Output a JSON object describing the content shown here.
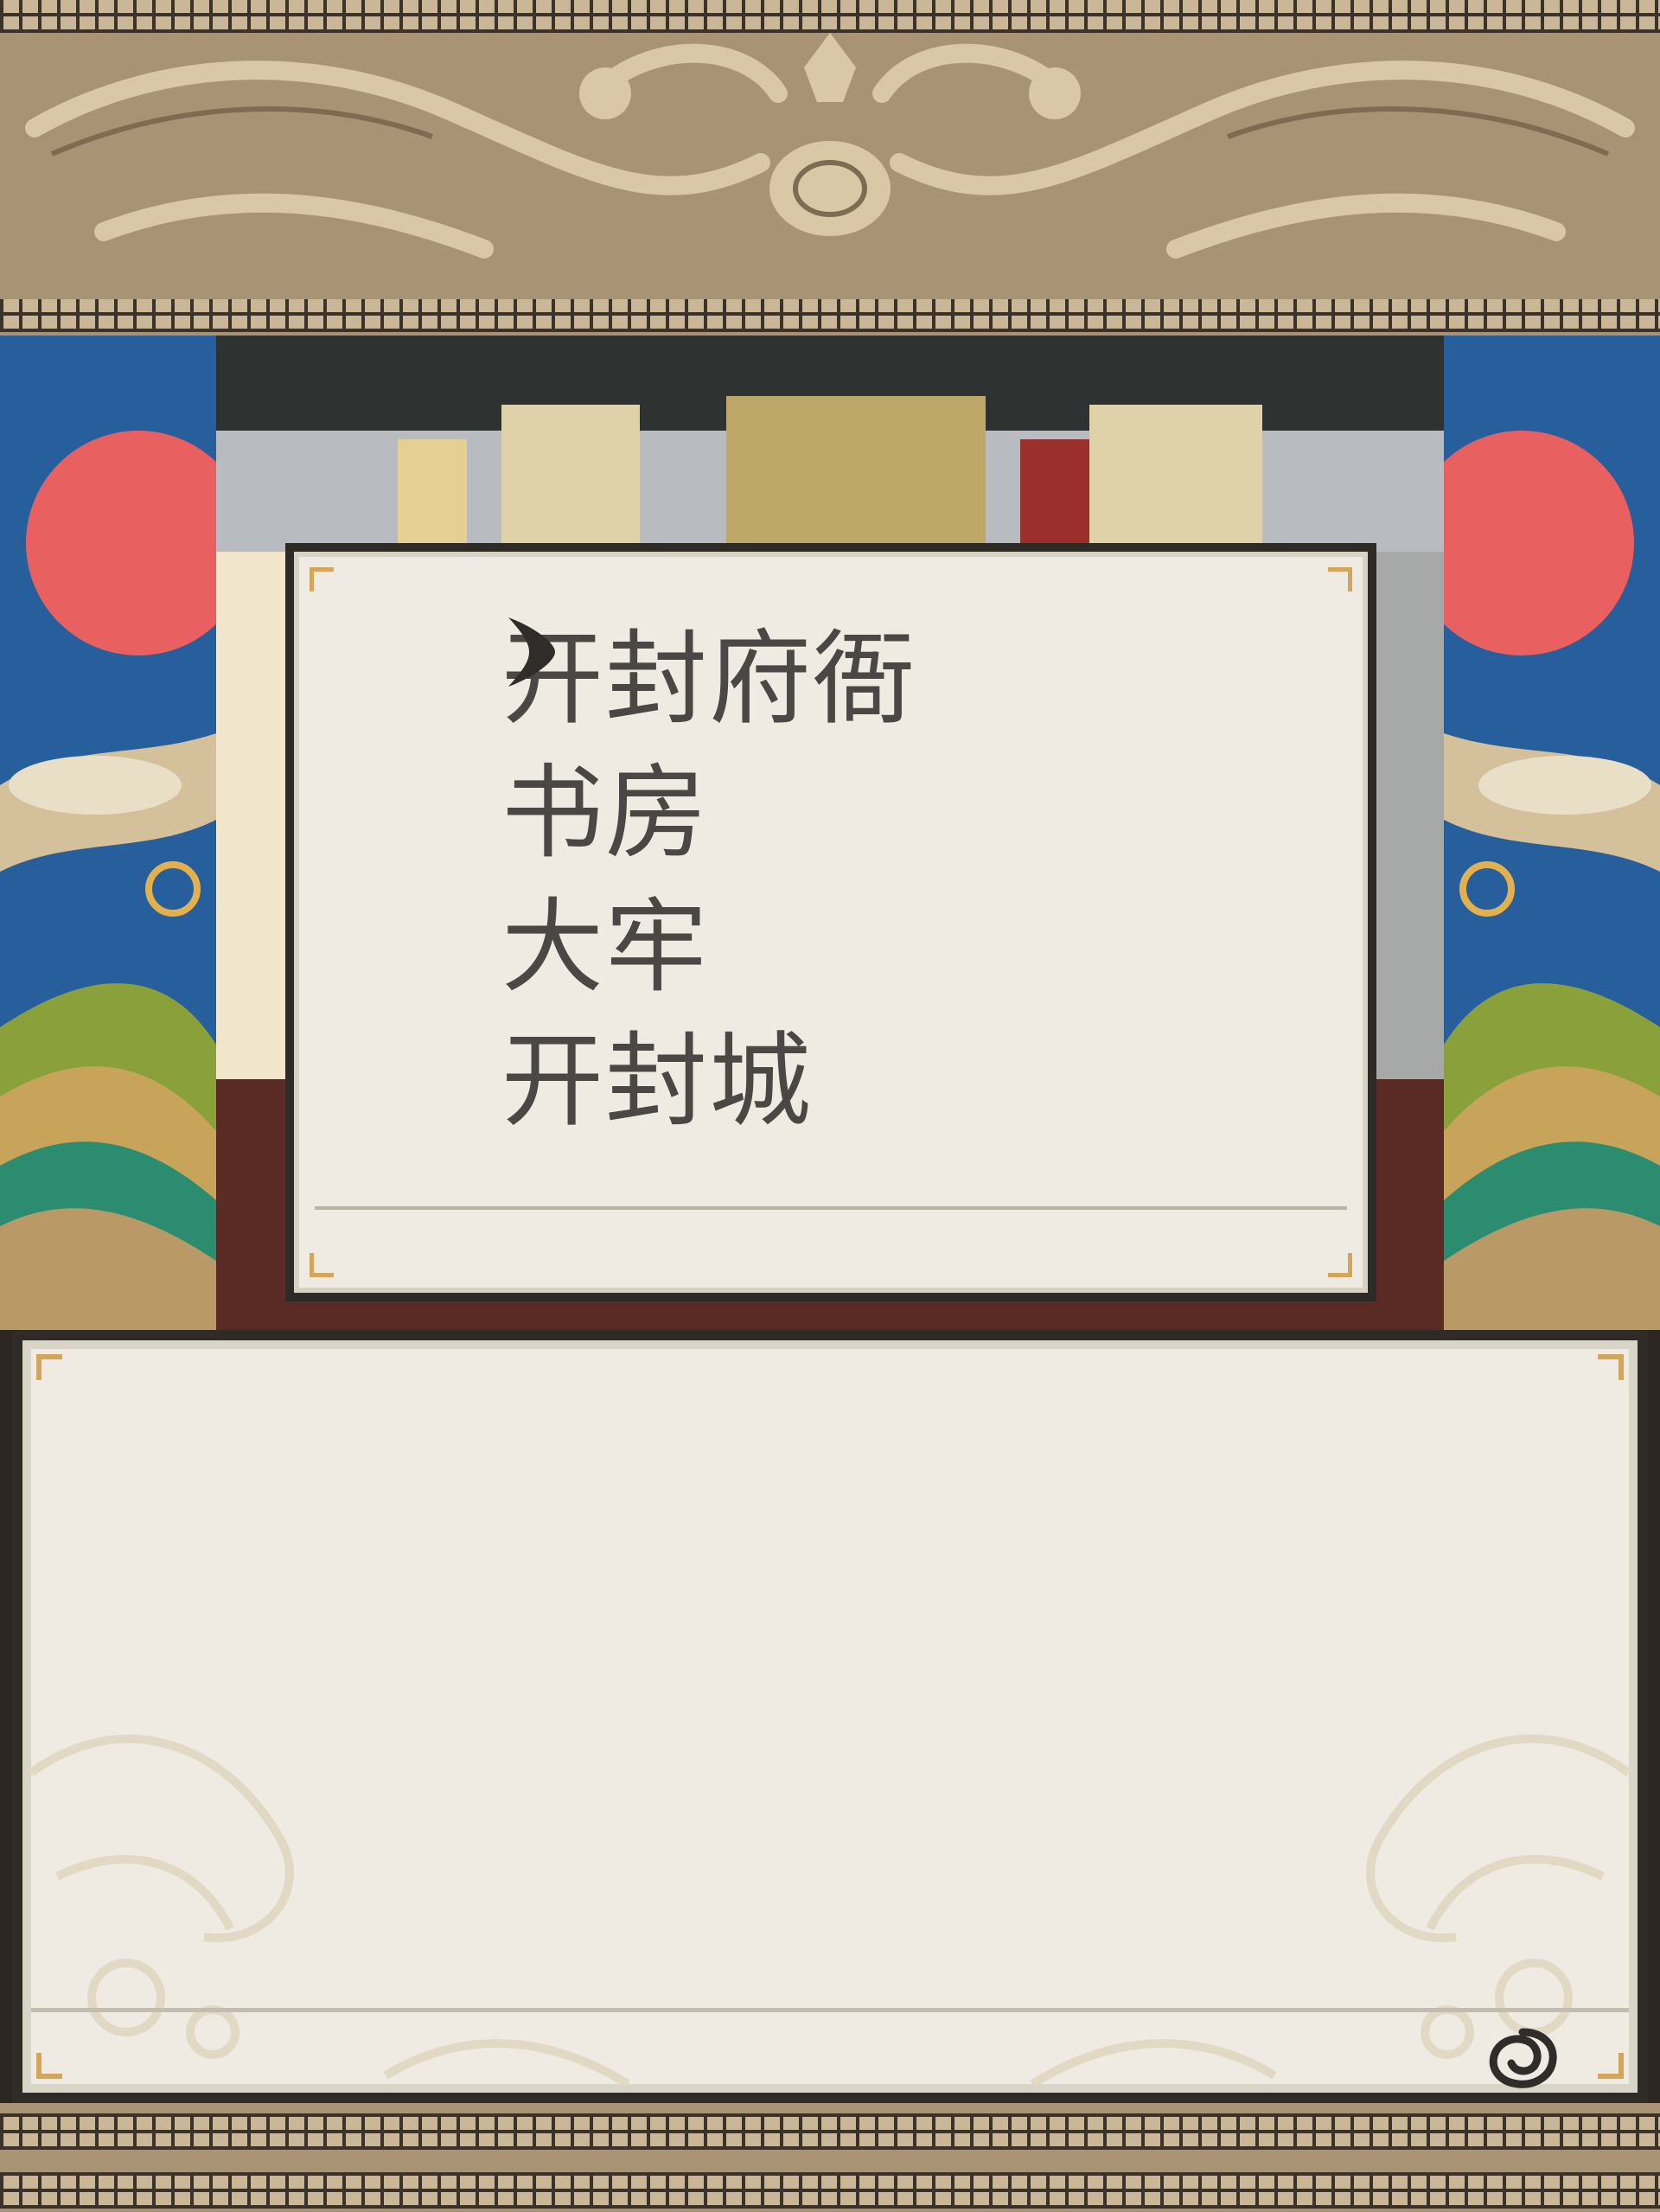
{
  "menu": {
    "items": [
      {
        "label": "开封府衙",
        "selected": true
      },
      {
        "label": "书房",
        "selected": false
      },
      {
        "label": "大牢",
        "selected": false
      },
      {
        "label": "开封城",
        "selected": false
      }
    ]
  },
  "message": {
    "text": ""
  },
  "icons": {
    "cursor": "chevron-right-icon",
    "advance": "swirl-advance-icon"
  },
  "colors": {
    "panel": "#efebe2",
    "panel_border": "#2e2a25",
    "frame": "#a89475",
    "sun": "#e8605f",
    "sky": "#275e9c",
    "text": "#4a4744"
  }
}
